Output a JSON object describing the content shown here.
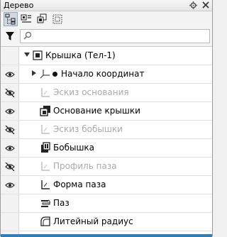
{
  "panel": {
    "title": "Дерево"
  },
  "search": {
    "value": "",
    "placeholder": ""
  },
  "tree": {
    "root": {
      "label": "Крышка (Тел-1)",
      "expanded": true
    },
    "items": [
      {
        "label": "Начало координат",
        "visible": true,
        "enabled": true,
        "icon": "origin-icon",
        "expandable": true
      },
      {
        "label": "Эскиз основания",
        "visible": false,
        "enabled": false,
        "icon": "sketch-icon"
      },
      {
        "label": "Основание крышки",
        "visible": true,
        "enabled": true,
        "icon": "extrude-icon"
      },
      {
        "label": "Эскиз бобышки",
        "visible": false,
        "enabled": false,
        "icon": "sketch-icon"
      },
      {
        "label": "Бобышка",
        "visible": true,
        "enabled": true,
        "icon": "boss-icon"
      },
      {
        "label": "Профиль паза",
        "visible": false,
        "enabled": false,
        "icon": "sketch-icon"
      },
      {
        "label": "Форма паза",
        "visible": true,
        "enabled": true,
        "icon": "sketch-icon"
      },
      {
        "label": "Паз",
        "visible": null,
        "enabled": true,
        "icon": "cut-icon"
      },
      {
        "label": "Литейный радиус",
        "visible": null,
        "enabled": true,
        "icon": "fillet-icon"
      }
    ]
  }
}
